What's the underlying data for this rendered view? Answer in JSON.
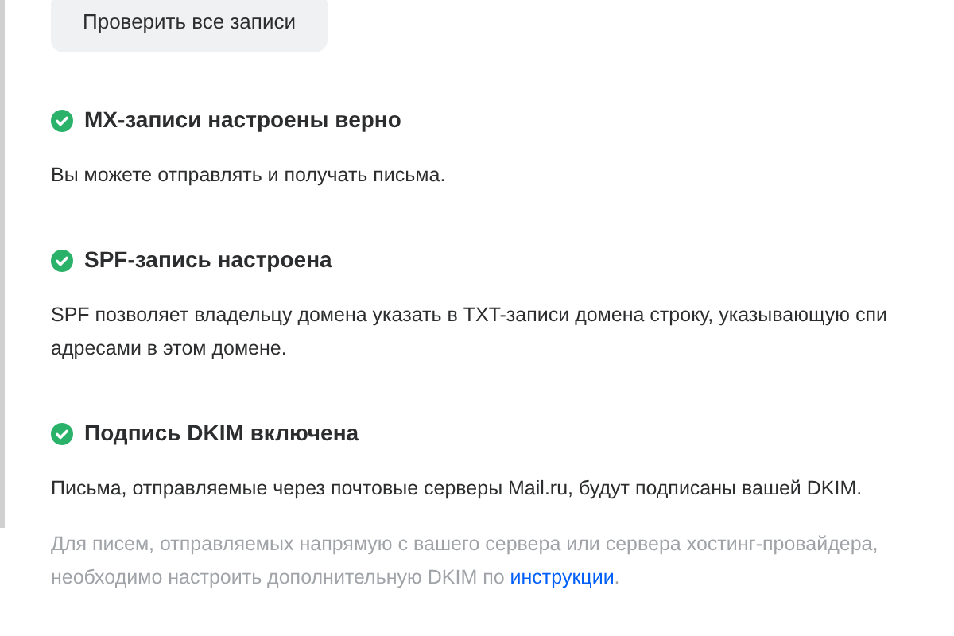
{
  "check_button": {
    "label": "Проверить все записи"
  },
  "sections": [
    {
      "ok": true,
      "title": "MX-записи настроены верно",
      "paragraphs": [
        {
          "kind": "body",
          "lines": [
            [
              {
                "text": "Вы можете отправлять и получать письма.",
                "link": false
              }
            ]
          ]
        }
      ]
    },
    {
      "ok": true,
      "title": "SPF-запись настроена",
      "paragraphs": [
        {
          "kind": "body",
          "lines": [
            [
              {
                "text": "SPF позволяет владельцу домена указать в TXT-записи домена строку, указывающую спи",
                "link": false
              }
            ],
            [
              {
                "text": "адресами в этом домене.",
                "link": false
              }
            ]
          ]
        }
      ]
    },
    {
      "ok": true,
      "title": "Подпись DKIM включена",
      "paragraphs": [
        {
          "kind": "body",
          "lines": [
            [
              {
                "text": "Письма, отправляемые через почтовые серверы Mail.ru, будут подписаны вашей DKIM.",
                "link": false
              }
            ]
          ]
        },
        {
          "kind": "note",
          "lines": [
            [
              {
                "text": "Для писем, отправляемых напрямую с вашего сервера или сервера хостинг-провайдера,",
                "link": false
              }
            ],
            [
              {
                "text": "необходимо настроить дополнительную DKIM по ",
                "link": false
              },
              {
                "text": "инструкции",
                "link": true
              },
              {
                "text": ".",
                "link": false
              }
            ]
          ]
        }
      ]
    }
  ]
}
